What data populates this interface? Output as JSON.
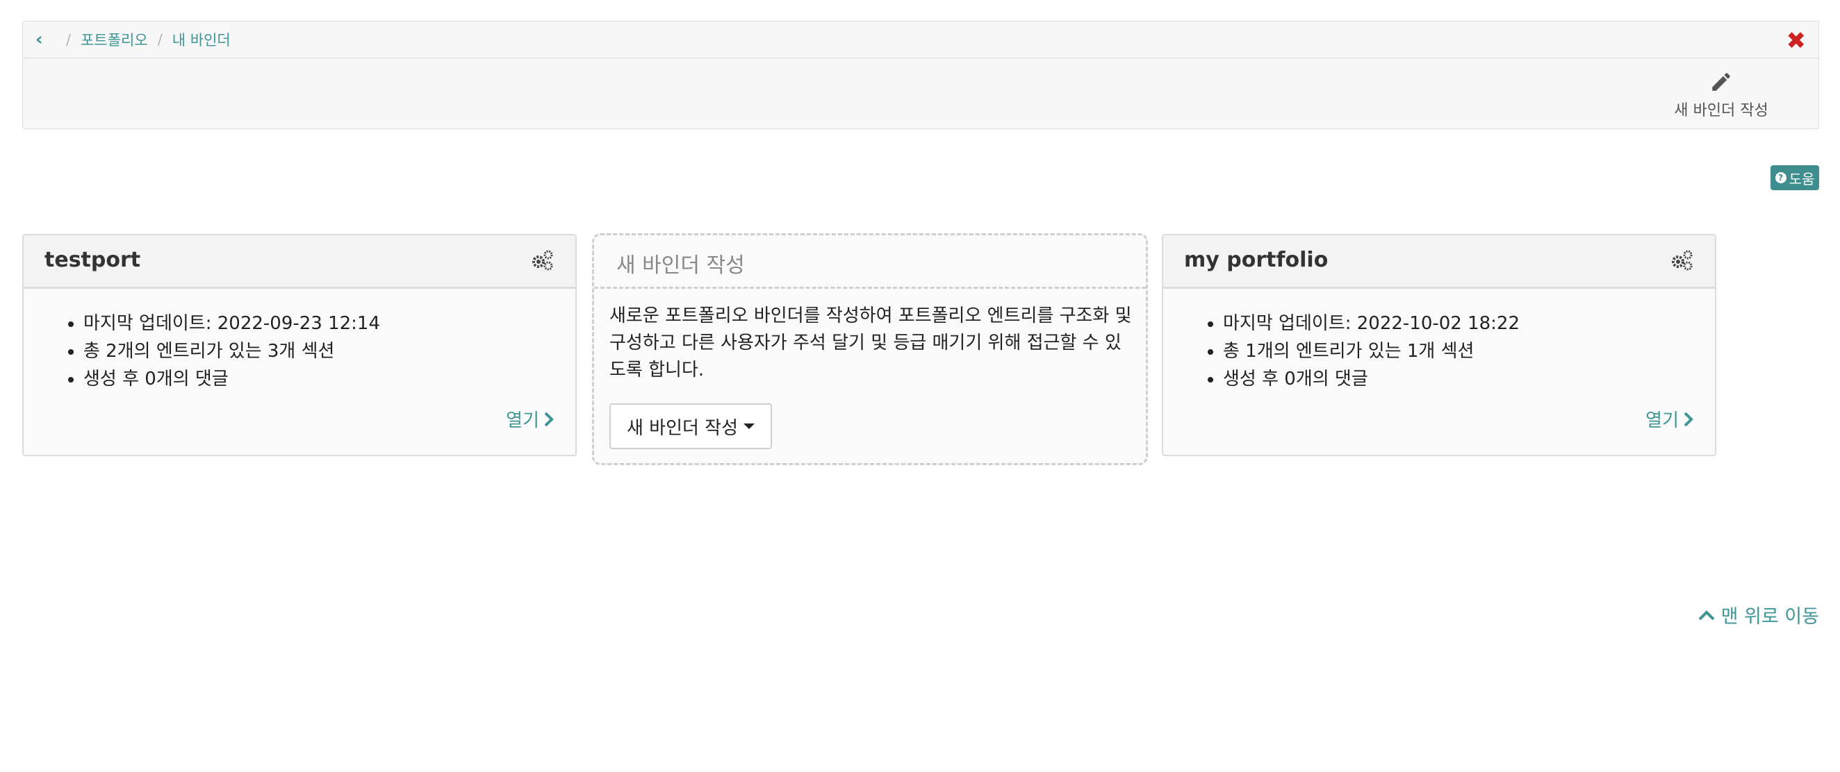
{
  "breadcrumb": {
    "items": [
      "포트폴리오",
      "내 바인더"
    ]
  },
  "toolbar": {
    "create_label": "새 바인더 작성"
  },
  "help": {
    "label": "도움"
  },
  "binders": [
    {
      "title": "testport",
      "details": [
        "마지막 업데이트: 2022-09-23 12:14",
        "총 2개의 엔트리가 있는 3개 섹션",
        "생성 후 0개의 댓글"
      ],
      "open_label": "열기"
    },
    {
      "title": "my portfolio",
      "details": [
        "마지막 업데이트: 2022-10-02 18:22",
        "총 1개의 엔트리가 있는 1개 섹션",
        "생성 후 0개의 댓글"
      ],
      "open_label": "열기"
    }
  ],
  "new_binder": {
    "title": "새 바인더 작성",
    "description": "새로운 포트폴리오 바인더를 작성하여 포트폴리오 엔트리를 구조화 및 구성하고 다른 사용자가 주석 달기 및 등급 매기기 위해 접근할 수 있도록 합니다.",
    "button_label": "새 바인더 작성"
  },
  "back_to_top": {
    "label": "맨 위로 이동"
  },
  "colors": {
    "accent": "#3e9596",
    "close": "#cc2222",
    "help_bg": "#3e8e8f"
  }
}
